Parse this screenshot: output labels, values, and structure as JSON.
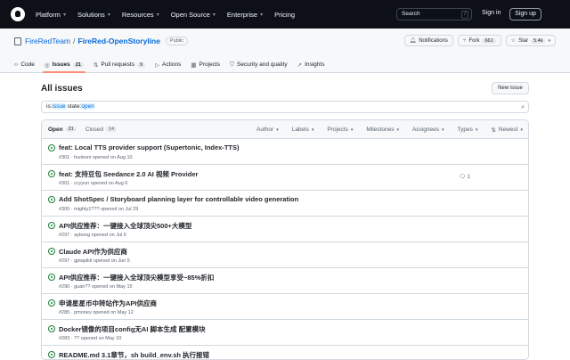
{
  "topnav": {
    "items": [
      {
        "label": "Platform"
      },
      {
        "label": "Solutions"
      },
      {
        "label": "Resources"
      },
      {
        "label": "Open Source"
      },
      {
        "label": "Enterprise"
      },
      {
        "label": "Pricing"
      }
    ],
    "search_label": "Search",
    "search_shortcut": "/",
    "signin": "Sign in",
    "signup": "Sign up"
  },
  "repo": {
    "owner": "FireRedTeam",
    "separator": "/",
    "name": "FireRed-OpenStoryline",
    "visibility": "Public",
    "notifications_label": "Notifications",
    "fork_label": "Fork",
    "fork_count": "661",
    "star_label": "Star",
    "star_count": "5.4k"
  },
  "tabs": [
    {
      "label": "Code",
      "icon": "code-icon"
    },
    {
      "label": "Issues",
      "count": "21",
      "icon": "issue-icon"
    },
    {
      "label": "Pull requests",
      "count": "9",
      "icon": "pull-request-icon"
    },
    {
      "label": "Actions",
      "icon": "play-icon"
    },
    {
      "label": "Projects",
      "icon": "table-icon"
    },
    {
      "label": "Security and quality",
      "icon": "shield-icon"
    },
    {
      "label": "Insights",
      "icon": "graph-icon"
    }
  ],
  "main": {
    "title": "All issues",
    "new_issue": "New issue",
    "filter_prefix": "is:",
    "filter_issue": "issue",
    "filter_mid": " state:",
    "filter_open": "open"
  },
  "list": {
    "open_label": "Open",
    "open_count": "21",
    "closed_label": "Closed",
    "closed_count": "14",
    "filters": [
      "Author",
      "Labels",
      "Projects",
      "Milestones",
      "Assignees",
      "Types"
    ],
    "sort_label": "Newest"
  },
  "issues": [
    {
      "title": "feat: Local TTS provider support (Supertonic, Index-TTS)",
      "meta": "#301 · hunkoni opened on Aug 10",
      "comments": ""
    },
    {
      "title": "feat: 支持豆包 Seedance 2.0 AI 视频 Provider",
      "meta": "#301 · ccyyun opened on Aug 6",
      "comments": "1"
    },
    {
      "title": "Add ShotSpec / Storyboard planning layer for controllable video generation",
      "meta": "#300 · mighty1??? opened on Jul 29",
      "comments": ""
    },
    {
      "title": "API供应推荐：一键接入全球顶尖500+大模型",
      "meta": "#297 · ayboog opened on Jul 6",
      "comments": ""
    },
    {
      "title": "Claude API作为供应商",
      "meta": "#297 · gptapikil opened on Jun 5",
      "comments": ""
    },
    {
      "title": "API供应推荐：一键接入全球顶尖模型享受~85%折扣",
      "meta": "#290 · guan?? opened on May 15",
      "comments": ""
    },
    {
      "title": "申请星星币中转站作为API供应商",
      "meta": "#285 · pmoney opened on May 12",
      "comments": ""
    },
    {
      "title": "Docker镜像的项目config无AI 脚本生成 配置模块",
      "meta": "#283 · ?? opened on May 10",
      "comments": ""
    },
    {
      "title": "README.md 3.1章节，sh build_env.sh 执行报错",
      "meta": "",
      "comments": ""
    }
  ]
}
